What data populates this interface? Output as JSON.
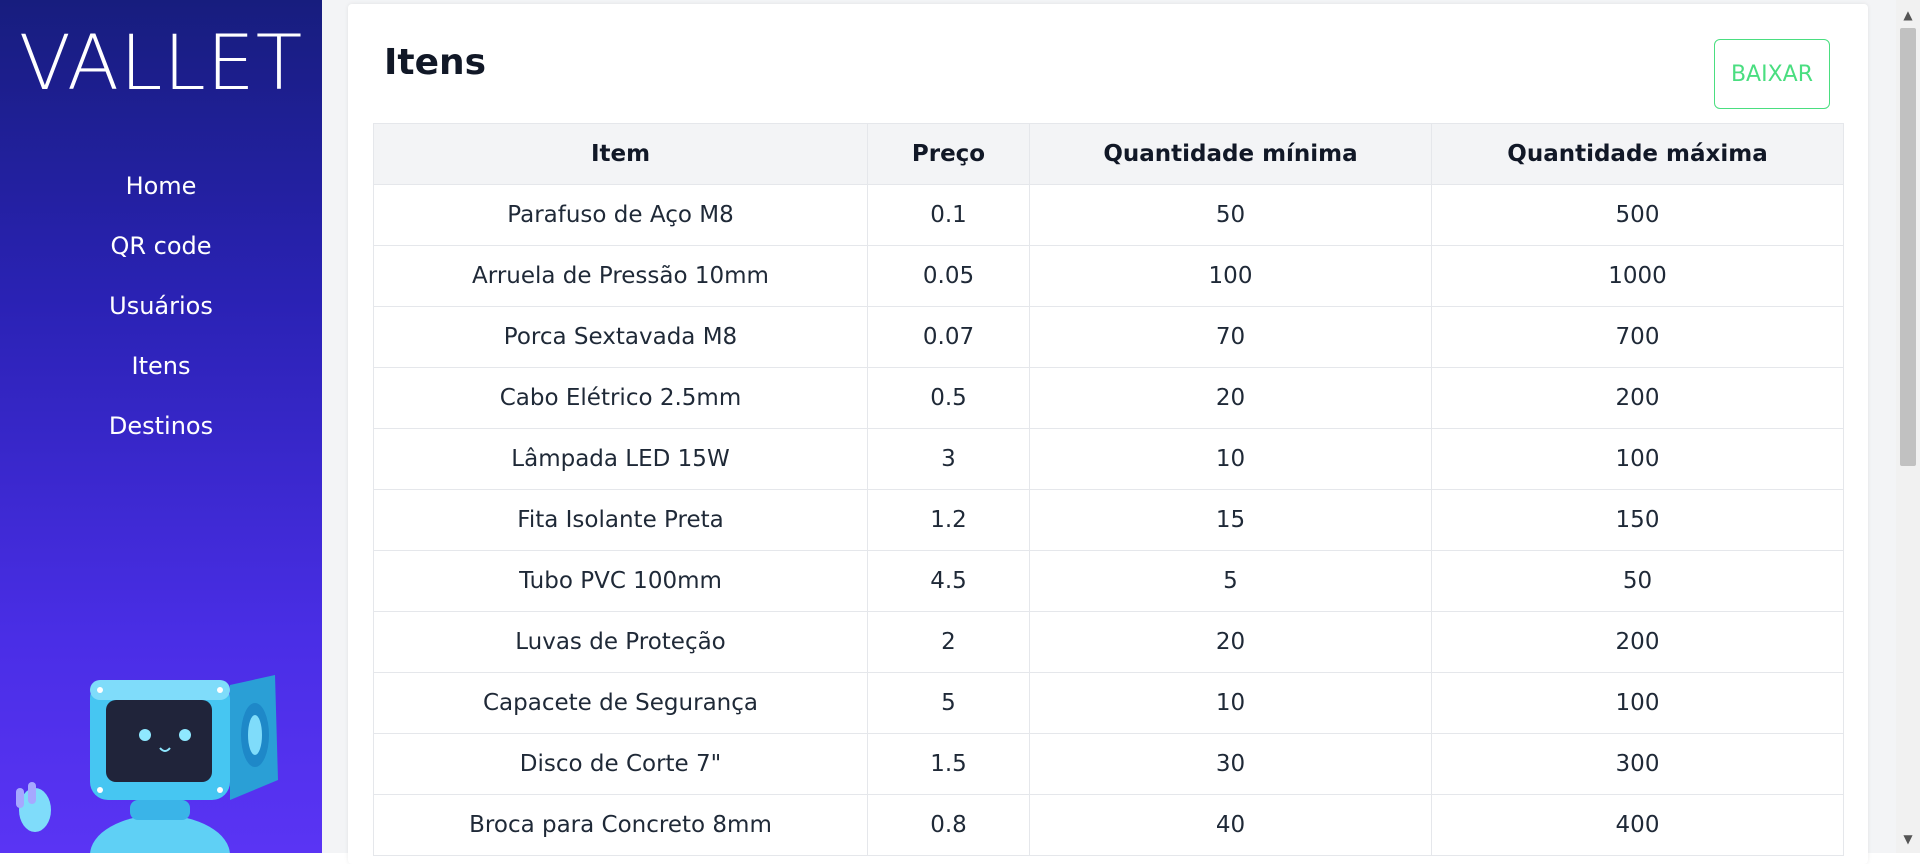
{
  "sidebar": {
    "logo": "VALLET",
    "items": [
      {
        "label": "Home"
      },
      {
        "label": "QR code"
      },
      {
        "label": "Usuários"
      },
      {
        "label": "Itens"
      },
      {
        "label": "Destinos"
      }
    ],
    "mascot_icon": "robot-mascot-icon"
  },
  "main": {
    "title": "Itens",
    "download_label": "BAIXAR",
    "table": {
      "headers": [
        "Item",
        "Preço",
        "Quantidade mínima",
        "Quantidade máxima"
      ],
      "rows": [
        [
          "Parafuso de Aço M8",
          "0.1",
          "50",
          "500"
        ],
        [
          "Arruela de Pressão 10mm",
          "0.05",
          "100",
          "1000"
        ],
        [
          "Porca Sextavada M8",
          "0.07",
          "70",
          "700"
        ],
        [
          "Cabo Elétrico 2.5mm",
          "0.5",
          "20",
          "200"
        ],
        [
          "Lâmpada LED 15W",
          "3",
          "10",
          "100"
        ],
        [
          "Fita Isolante Preta",
          "1.2",
          "15",
          "150"
        ],
        [
          "Tubo PVC 100mm",
          "4.5",
          "5",
          "50"
        ],
        [
          "Luvas de Proteção",
          "2",
          "20",
          "200"
        ],
        [
          "Capacete de Segurança",
          "5",
          "10",
          "100"
        ],
        [
          "Disco de Corte 7\"",
          "1.5",
          "30",
          "300"
        ],
        [
          "Broca para Concreto 8mm",
          "0.8",
          "40",
          "400"
        ]
      ]
    }
  },
  "colors": {
    "sidebar_top": "#171d7e",
    "sidebar_bottom": "#5a34f4",
    "download_accent": "#4ade80"
  }
}
